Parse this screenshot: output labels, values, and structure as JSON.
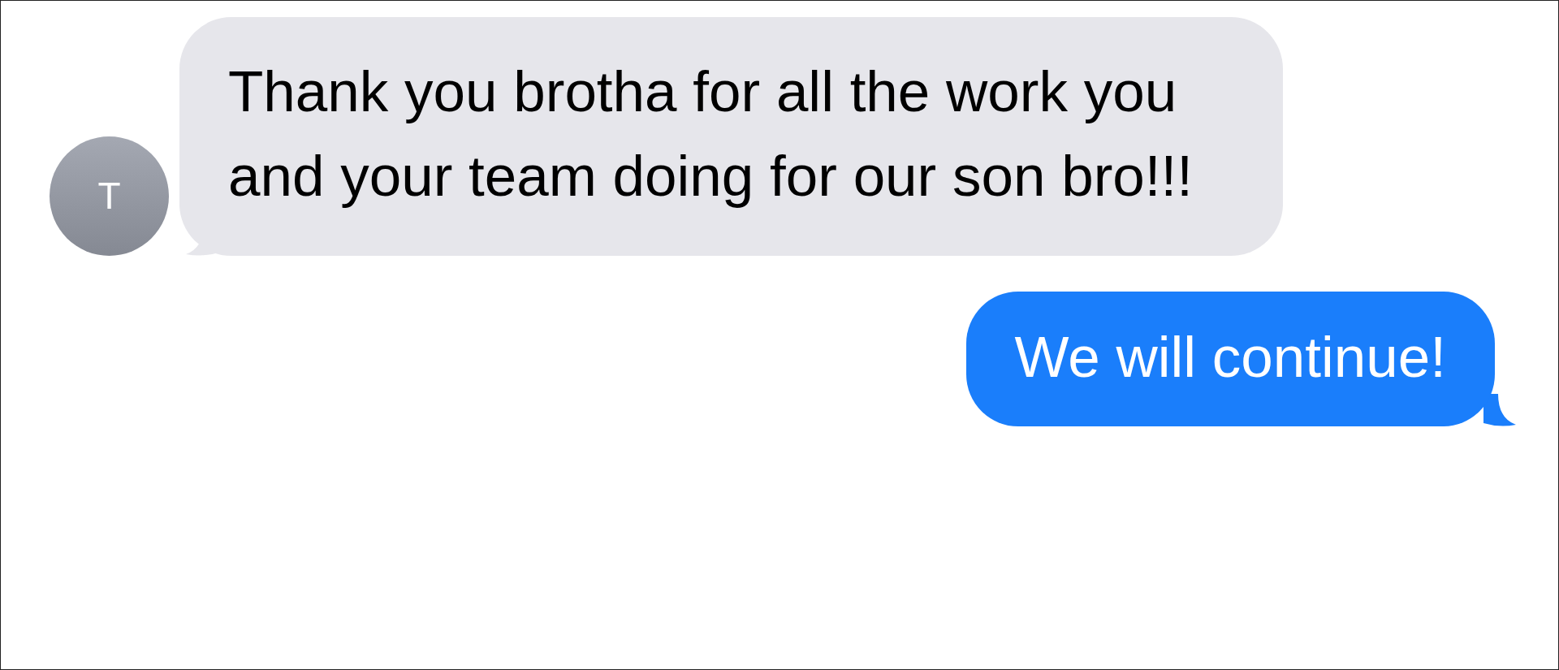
{
  "messages": [
    {
      "kind": "incoming",
      "avatar": "T",
      "text": "Thank you brotha for all the work you and your team doing for our son bro!!!"
    },
    {
      "kind": "outgoing",
      "text": "We will continue!"
    }
  ]
}
